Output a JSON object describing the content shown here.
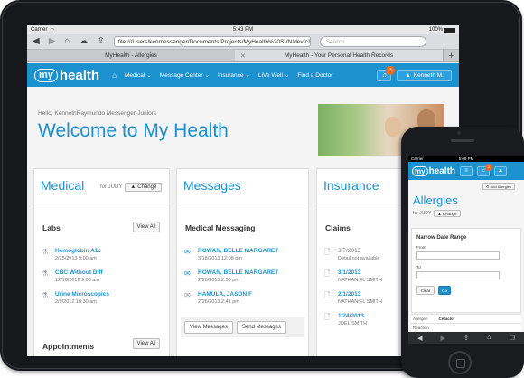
{
  "ipad": {
    "status": {
      "carrier": "Carrier",
      "time": "5:43 PM",
      "battery": "100%"
    },
    "toolbar": {
      "url": "file:///Users/kenmessenger/Documents/Projects/MyHealth%20SVN/dev/c",
      "search_placeholder": "Search"
    },
    "tabs": [
      {
        "label": "MyHealth - Allergies"
      },
      {
        "label": "MyHealth - Your Personal Health Records"
      }
    ],
    "nav": {
      "logo_my": "my",
      "logo_health": "health",
      "links": [
        "Medical",
        "Message Center",
        "Insurance",
        "LiVe Well",
        "Find a Doctor"
      ],
      "notification_count": "3",
      "user": "Kenneth M."
    },
    "hero": {
      "hello": "Hello, KennethRaymundo Messenger-Juniors",
      "welcome": "Welcome to My Health"
    },
    "medical": {
      "title": "Medical",
      "for_label": "for JUDY",
      "change": "Change",
      "labs_title": "Labs",
      "view_all": "View All",
      "labs": [
        {
          "name": "Hemoglobin A1c",
          "date": "2/25/2013 9:00 am"
        },
        {
          "name": "CBC Without Diff",
          "date": "12/18/2012 9:00 am"
        },
        {
          "name": "Urine Microscopics",
          "date": "2/9/2012 10:30 am"
        }
      ],
      "appointments_title": "Appointments",
      "appointments_view_all": "View All"
    },
    "messages": {
      "title": "Messages",
      "section": "Medical Messaging",
      "items": [
        {
          "name": "ROWAN, BELLE MARGARET",
          "date": "3/18/2013 12:08 pm"
        },
        {
          "name": "ROWAN, BELLE MARGARET",
          "date": "2/26/2013 2:50 pm"
        },
        {
          "name": "HAMULA, JASON F",
          "date": "2/26/2013 2:41 pm"
        }
      ],
      "view_button": "View Messages",
      "send_button": "Send Messages"
    },
    "insurance": {
      "title": "Insurance",
      "section": "Claims",
      "claims": [
        {
          "date": "3/7/2013",
          "detail": "Detail not available"
        },
        {
          "date": "3/1/2013",
          "detail": "NATHANIEL SMITH"
        },
        {
          "date": "2/1/2013",
          "detail": "NATHANIEL SMITH"
        },
        {
          "date": "1/24/2013",
          "detail": "JOEL SMITH"
        }
      ]
    }
  },
  "iphone": {
    "status": {
      "carrier": "Carrier",
      "time": "5:09 PM"
    },
    "notification_count": "3",
    "add_button": "Add Allergies",
    "title": "Allergies",
    "for_label": "for JUDY",
    "change": "Change",
    "panel_title": "Narrow Date Range",
    "from_label": "From",
    "to_label": "To",
    "clear": "Clear",
    "go": "Go",
    "table": [
      {
        "label": "Allergen",
        "value": "Cefaclor"
      },
      {
        "label": "Reaction",
        "value": ""
      }
    ]
  }
}
